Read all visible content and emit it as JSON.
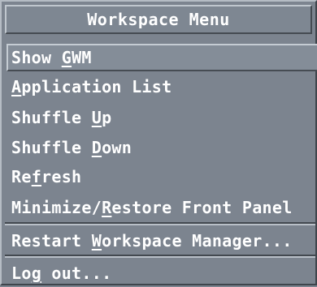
{
  "menu": {
    "title": "Workspace Menu",
    "items": [
      {
        "pre": "Show ",
        "mn": "G",
        "post": "WM",
        "selected": true
      },
      {
        "pre": "",
        "mn": "A",
        "post": "pplication List",
        "selected": false
      },
      {
        "pre": "Shuffle ",
        "mn": "U",
        "post": "p",
        "selected": false
      },
      {
        "pre": "Shuffle ",
        "mn": "D",
        "post": "own",
        "selected": false
      },
      {
        "pre": "Re",
        "mn": "f",
        "post": "resh",
        "selected": false
      },
      {
        "pre": "Minimize/",
        "mn": "R",
        "post": "estore Front Panel",
        "selected": false
      },
      {
        "pre": "Restart ",
        "mn": "W",
        "post": "orkspace Manager...",
        "selected": false
      },
      {
        "pre": "Lo",
        "mn": "g",
        "post": " out...",
        "selected": false
      }
    ]
  },
  "colors": {
    "background": "#7c848f",
    "text": "#ffffff",
    "bevel_light": "#b5bcc4",
    "bevel_dark": "#3f454c"
  }
}
